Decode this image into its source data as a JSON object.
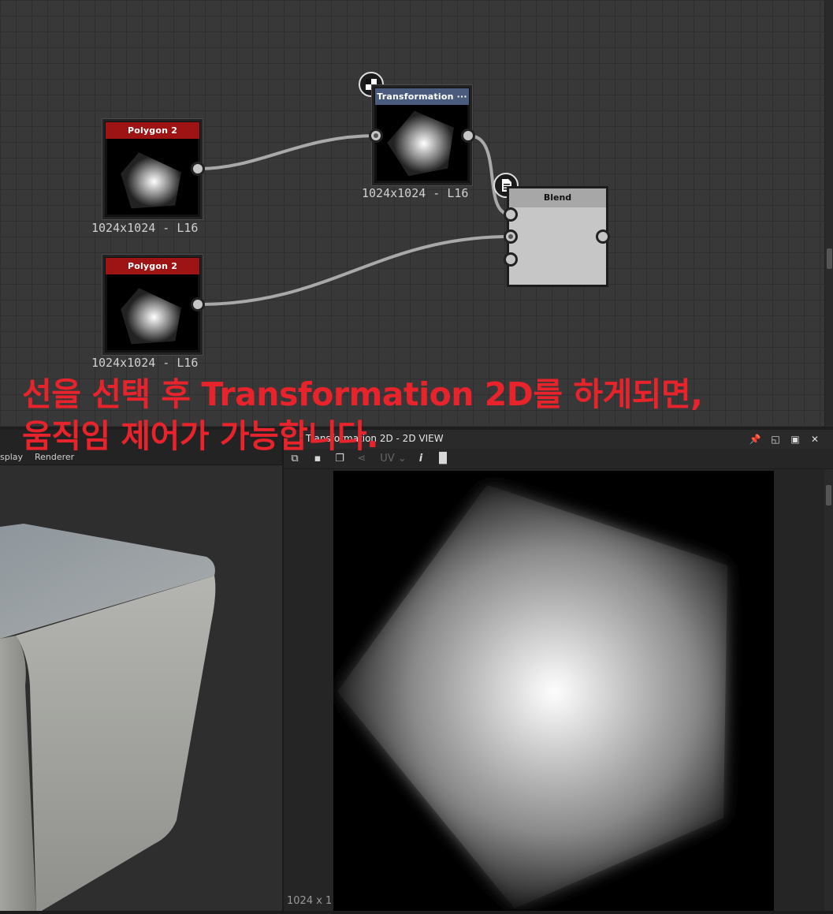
{
  "graph": {
    "nodes": [
      {
        "title": "Polygon 2",
        "caption": "1024x1024 - L16",
        "title_color": "#9e1414"
      },
      {
        "title": "Polygon 2",
        "caption": "1024x1024 - L16",
        "title_color": "#9e1414"
      },
      {
        "title": "Transformation ···",
        "caption": "1024x1024 - L16",
        "title_color": "#4a5b7e"
      },
      {
        "title": "Blend"
      }
    ],
    "icons": [
      "checker-icon",
      "document-icon"
    ]
  },
  "annotation": {
    "line1": "선을 선택 후 Transformation 2D를 하게되면,",
    "line2": "움직임 제어가 가능합니다."
  },
  "left_panel": {
    "tabs": [
      "splay",
      "Renderer"
    ]
  },
  "view2d": {
    "title": "Transformation 2D - 2D VIEW",
    "toolbar": {
      "uv": "UV",
      "info": "i"
    },
    "resolution": "1024 x 1"
  },
  "colors": {
    "accent_red": "#e8232b",
    "polygon_header": "#9e1414",
    "transform_header": "#4a5b7e"
  }
}
